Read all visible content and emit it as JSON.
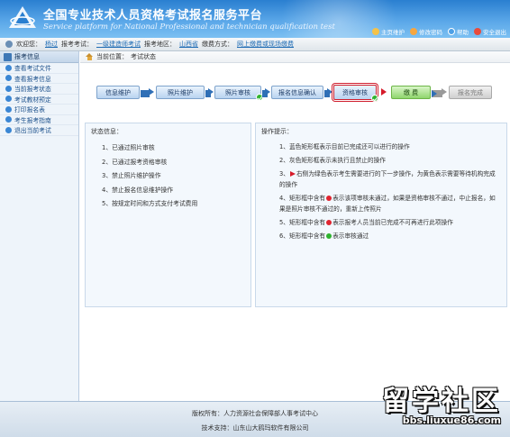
{
  "header": {
    "title": "全国专业技术人员资格考试报名服务平台",
    "subtitle": "Service platform for National Professional and technician qualification test",
    "links": [
      {
        "label": "主页维护",
        "icon": "home-icon"
      },
      {
        "label": "修改密码",
        "icon": "key-icon"
      },
      {
        "label": "帮助",
        "icon": "help-icon"
      },
      {
        "label": "安全退出",
        "icon": "exit-icon"
      }
    ]
  },
  "userbar": {
    "welcome_label": "欢迎您：",
    "user_name": "杨过",
    "exam_label": "报考考试：",
    "exam_value": "一级建造师考试",
    "region_label": "报考地区：",
    "region_value": "山西省",
    "pay_label": "缴费方式：",
    "pay_value": "网上缴费或现场缴费"
  },
  "sidebar": {
    "title": "报考信息",
    "items": [
      {
        "label": "查看考试文件"
      },
      {
        "label": "查看报考信息"
      },
      {
        "label": "当前报考状态"
      },
      {
        "label": "考试教材预定"
      },
      {
        "label": "打印报名表"
      },
      {
        "label": "考生报考指南"
      },
      {
        "label": "退出当前考试"
      }
    ]
  },
  "breadcrumb": {
    "prefix": "当前位置：",
    "current": "考试状态"
  },
  "steps": [
    {
      "label": "信息维护",
      "state": "done"
    },
    {
      "label": "照片维护",
      "state": "done"
    },
    {
      "label": "照片审核",
      "state": "done"
    },
    {
      "label": "报名信息确认",
      "state": "pending"
    },
    {
      "label": "资格审核",
      "state": "current"
    },
    {
      "label": "缴 费",
      "state": "next"
    },
    {
      "label": "报名完成",
      "state": "disabled"
    }
  ],
  "status_panel": {
    "title": "状态信息：",
    "items": [
      "1、已通过照片审核",
      "2、已通过报考资格审核",
      "3、禁止照片维护操作",
      "4、禁止报名信息维护操作",
      "5、按规定时间和方式支付考试费用"
    ]
  },
  "ops_panel": {
    "title": "操作提示：",
    "items": [
      {
        "num": "1、",
        "marker": "",
        "text": "蓝色矩形框表示目前已完成还可以进行的操作"
      },
      {
        "num": "2、",
        "marker": "",
        "text": "灰色矩形框表示未执行且禁止的操作"
      },
      {
        "num": "3、",
        "marker": "arrow",
        "text": "右侧为绿色表示考生需要进行的下一步操作，为黄色表示需要等待机构完成的操作"
      },
      {
        "num": "4、",
        "marker": "red",
        "prefix": "矩形框中含有",
        "text": "表示该项审核未通过，如果是资格审核不通过，中止报名，如果是照片审核不通过的，重新上传照片"
      },
      {
        "num": "5、",
        "marker": "red",
        "prefix": "矩形框中含有",
        "text": "表示报考人员当前已完成不可再进行此项操作"
      },
      {
        "num": "6、",
        "marker": "green",
        "prefix": "矩形框中含有",
        "text": "表示审核通过"
      }
    ]
  },
  "footer": {
    "copyright": "版权所有：人力资源社会保障部人事考试中心",
    "support": "技术支持：山东山大鸥玛软件有限公司"
  },
  "watermark": {
    "title": "留学社区",
    "url": "bbs.liuxue86.com"
  }
}
